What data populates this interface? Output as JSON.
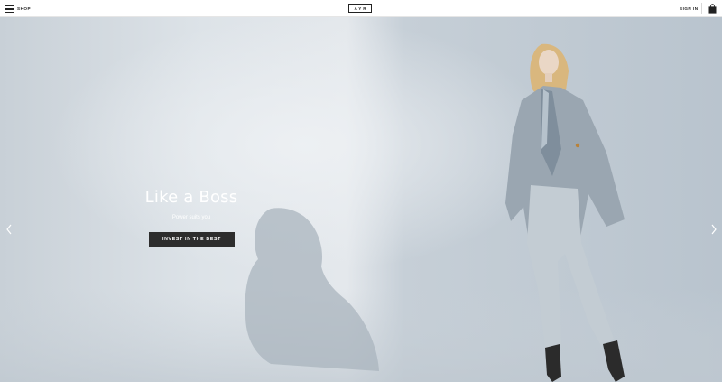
{
  "header": {
    "menu_label": "SHOP",
    "logo_text": "AYR",
    "signin_label": "SIGN IN"
  },
  "hero": {
    "headline": "Like a Boss",
    "subline": "Power suits you",
    "cta_label": "INVEST IN THE BEST"
  },
  "colors": {
    "background": "#ffffff",
    "text_dark": "#222222",
    "cta_background": "#2d2d2d",
    "hero_backdrop": "#c9d3db"
  },
  "icons": [
    "menu-icon",
    "shopping-bag-icon",
    "chevron-left-icon",
    "chevron-right-icon"
  ]
}
